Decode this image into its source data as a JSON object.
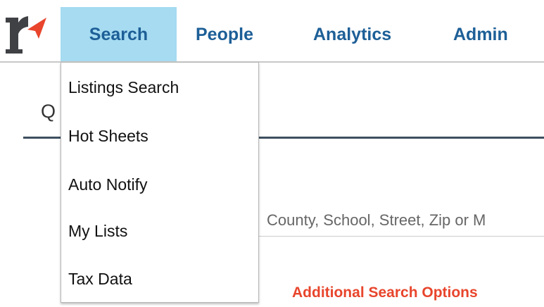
{
  "nav": {
    "tabs": [
      {
        "label": "Search",
        "active": true
      },
      {
        "label": "People"
      },
      {
        "label": "Analytics"
      },
      {
        "label": "Admin"
      }
    ]
  },
  "search_menu": {
    "items": [
      "Listings Search",
      "Hot Sheets",
      "Auto Notify",
      "My Lists",
      "Tax Data"
    ]
  },
  "main": {
    "section_title_partial": "Q",
    "search_placeholder": "County, School, Street, Zip or M",
    "more_options_label": "Additional Search Options"
  },
  "colors": {
    "nav_text": "#1d5f97",
    "active_tab_bg": "#a6dbf1",
    "accent_orange": "#e8452c",
    "logo_dark": "#3f4145",
    "divider_dark": "#3d4f5f"
  },
  "icons": {
    "logo": "r-arrow-logo"
  }
}
